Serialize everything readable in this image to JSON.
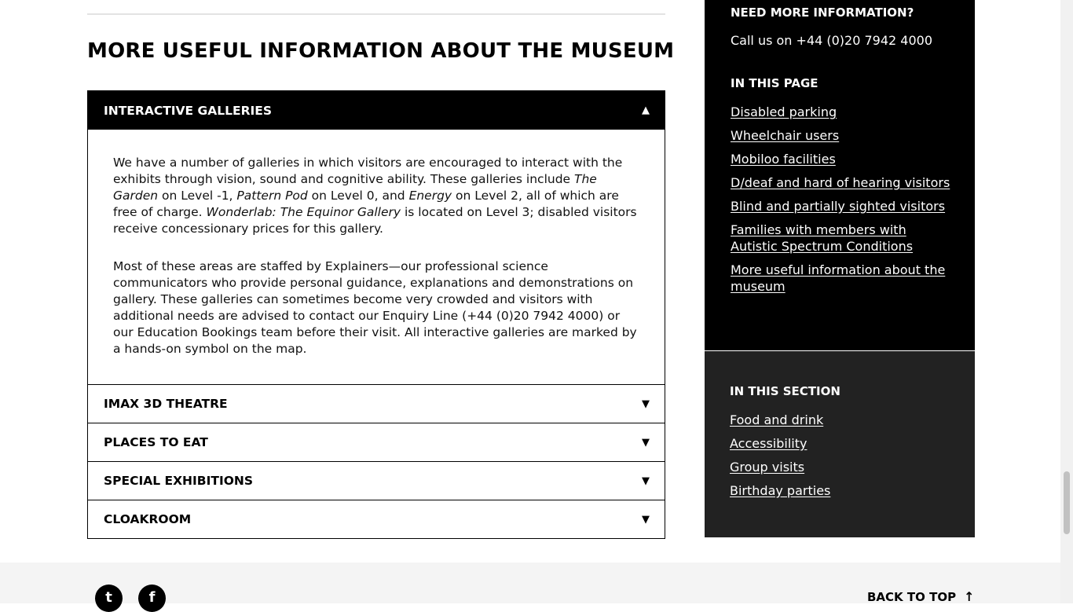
{
  "main": {
    "heading": "MORE USEFUL INFORMATION ABOUT THE MUSEUM",
    "accordion": [
      {
        "title": "INTERACTIVE GALLERIES",
        "open": true,
        "body": {
          "p1": {
            "a": "We have a number of galleries in which visitors are encouraged to interact with the exhibits through vision, sound and cognitive ability. These galleries include ",
            "b": "The Garden",
            "c": " on Level -1, ",
            "d": "Pattern Pod",
            "e": " on Level 0, and ",
            "f": "Energy",
            "g": " on Level 2, all of which are free of charge. ",
            "h": "Wonderlab: The Equinor Gallery",
            "i": " is located on Level 3; disabled visitors receive concessionary prices for this gallery."
          },
          "p2": "Most of these areas are staffed by Explainers—our professional science communicators who provide personal guidance, explanations and demonstrations on gallery. These galleries can sometimes become very crowded and visitors with additional needs are advised to contact our Enquiry Line (+44 (0)20 7942 4000) or our Education Bookings team before their visit. All interactive galleries are marked by a hands-on symbol on the map."
        }
      },
      {
        "title": "IMAX 3D THEATRE",
        "open": false
      },
      {
        "title": "PLACES TO EAT",
        "open": false
      },
      {
        "title": "SPECIAL EXHIBITIONS",
        "open": false
      },
      {
        "title": "CLOAKROOM",
        "open": false
      }
    ],
    "caret_open": "▲",
    "caret_closed": "▼"
  },
  "aside": {
    "info_title": "NEED MORE INFORMATION?",
    "phone_text": "Call us on +44 (0)20 7942 4000",
    "in_page_title": "IN THIS PAGE",
    "in_page_links": [
      "Disabled parking",
      "Wheelchair users",
      "Mobiloo facilities",
      "D/deaf and hard of hearing visitors",
      "Blind and partially sighted visitors",
      "Families with members with Autistic Spectrum Conditions",
      "More useful information about the museum"
    ],
    "in_section_title": "IN THIS SECTION",
    "in_section_links": [
      "Food and drink",
      "Accessibility",
      "Group visits",
      "Birthday parties"
    ]
  },
  "footer": {
    "twitter_glyph": "t",
    "facebook_glyph": "f",
    "back_to_top": "BACK TO TOP",
    "back_to_top_arrow": "↑"
  },
  "colors": {
    "black_panel": "#000000",
    "dark_panel": "#222222",
    "footer_bg": "#f4f4f4"
  }
}
